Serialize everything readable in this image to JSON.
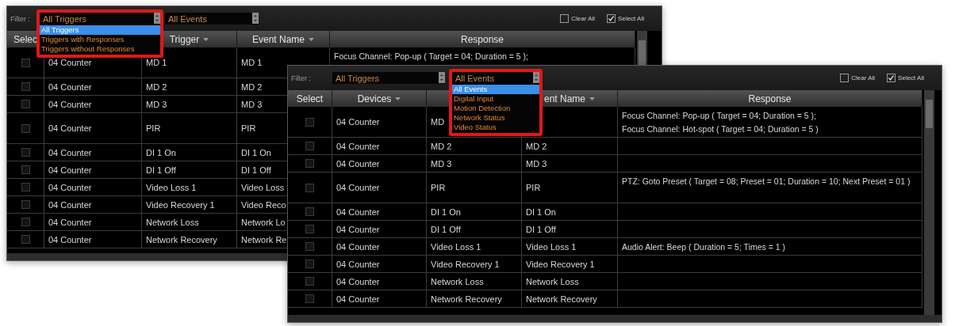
{
  "windows": [
    {
      "filter": {
        "label": "Filter :",
        "selects": [
          {
            "value": "All Triggers",
            "open": true,
            "options": [
              {
                "label": "All Triggers",
                "selected": true
              },
              {
                "label": "Triggers with Responses",
                "selected": false
              },
              {
                "label": "Triggers without Responses",
                "selected": false
              }
            ]
          },
          {
            "value": "All Events",
            "open": false
          }
        ]
      },
      "checks": [
        {
          "label": "Clear All",
          "checked": false
        },
        {
          "label": "Select All",
          "checked": true
        }
      ],
      "columns": [
        {
          "label": "Selec",
          "sortable": false
        },
        {},
        {
          "label": "Trigger",
          "sortable": true
        },
        {
          "label": "Event Name",
          "sortable": true
        },
        {
          "label": "Response",
          "sortable": false
        }
      ],
      "rows": [
        {
          "kind": "double",
          "checked": false,
          "device": "04 Counter",
          "trigger": "MD 1",
          "event_name": "MD 1",
          "response": [
            "Focus Channel: Pop-up ( Target = 04; Duration = 5 );"
          ]
        },
        {
          "kind": "single",
          "checked": false,
          "device": "04 Counter",
          "trigger": "MD 2",
          "event_name": "MD 2"
        },
        {
          "kind": "single",
          "checked": false,
          "device": "04 Counter",
          "trigger": "MD 3",
          "event_name": "MD 3"
        },
        {
          "kind": "double",
          "checked": false,
          "device": "04 Counter",
          "trigger": "PIR",
          "event_name": "PIR"
        },
        {
          "kind": "single",
          "checked": false,
          "device": "04 Counter",
          "trigger": "DI 1 On",
          "event_name": "DI 1 On"
        },
        {
          "kind": "single",
          "checked": false,
          "device": "04 Counter",
          "trigger": "DI 1 Off",
          "event_name": "DI 1 Off"
        },
        {
          "kind": "single",
          "checked": false,
          "device": "04 Counter",
          "trigger": "Video Loss 1",
          "event_name": "Video Loss"
        },
        {
          "kind": "single",
          "checked": false,
          "device": "04 Counter",
          "trigger": "Video Recovery 1",
          "event_name": "Video Reco"
        },
        {
          "kind": "single",
          "checked": false,
          "device": "04 Counter",
          "trigger": "Network Loss",
          "event_name": "Network Lo"
        },
        {
          "kind": "single",
          "checked": false,
          "device": "04 Counter",
          "trigger": "Network Recovery",
          "event_name": "Network Re"
        }
      ]
    },
    {
      "filter": {
        "label": "Filter :",
        "selects": [
          {
            "value": "All Triggers",
            "open": false
          },
          {
            "value": "All Events",
            "open": true,
            "options": [
              {
                "label": "All Events",
                "selected": true
              },
              {
                "label": "Digital Input",
                "selected": false
              },
              {
                "label": "Motion Detection",
                "selected": false
              },
              {
                "label": "Network Status",
                "selected": false
              },
              {
                "label": "Video Status",
                "selected": false
              }
            ]
          }
        ]
      },
      "checks": [
        {
          "label": "Clear All",
          "checked": false
        },
        {
          "label": "Select All",
          "checked": true
        }
      ],
      "columns": [
        {
          "label": "Select",
          "sortable": false
        },
        {
          "label": "Devices",
          "sortable": true
        },
        {},
        {
          "label": "ent Name",
          "sortable": true
        },
        {
          "label": "Response",
          "sortable": false
        }
      ],
      "rows": [
        {
          "kind": "double",
          "checked": false,
          "device": "04 Counter",
          "trigger": "MD",
          "response": [
            "Focus Channel: Pop-up ( Target = 04; Duration = 5 );",
            "Focus Channel: Hot-spot ( Target = 04; Duration = 5 )"
          ]
        },
        {
          "kind": "single",
          "checked": false,
          "device": "04 Counter",
          "trigger": "MD 2",
          "event_name": "MD 2"
        },
        {
          "kind": "single",
          "checked": false,
          "device": "04 Counter",
          "trigger": "MD 3",
          "event_name": "MD 3"
        },
        {
          "kind": "double",
          "checked": false,
          "device": "04 Counter",
          "trigger": "PIR",
          "event_name": "PIR",
          "response": [
            "PTZ: Goto Preset ( Target = 08; Preset = 01; Duration = 10; Next Preset = 01 )"
          ]
        },
        {
          "kind": "single",
          "checked": false,
          "device": "04 Counter",
          "trigger": "DI 1 On",
          "event_name": "DI 1 On"
        },
        {
          "kind": "single",
          "checked": false,
          "device": "04 Counter",
          "trigger": "DI 1 Off",
          "event_name": "DI 1 Off"
        },
        {
          "kind": "single",
          "checked": false,
          "device": "04 Counter",
          "trigger": "Video Loss 1",
          "event_name": "Video Loss 1",
          "response": [
            "Audio Alert: Beep ( Duration = 5; Times = 1 )"
          ]
        },
        {
          "kind": "single",
          "checked": false,
          "device": "04 Counter",
          "trigger": "Video Recovery 1",
          "event_name": "Video Recovery 1"
        },
        {
          "kind": "single",
          "checked": false,
          "device": "04 Counter",
          "trigger": "Network Loss",
          "event_name": "Network Loss"
        },
        {
          "kind": "single",
          "checked": false,
          "device": "04 Counter",
          "trigger": "Network Recovery",
          "event_name": "Network Recovery"
        }
      ]
    }
  ]
}
